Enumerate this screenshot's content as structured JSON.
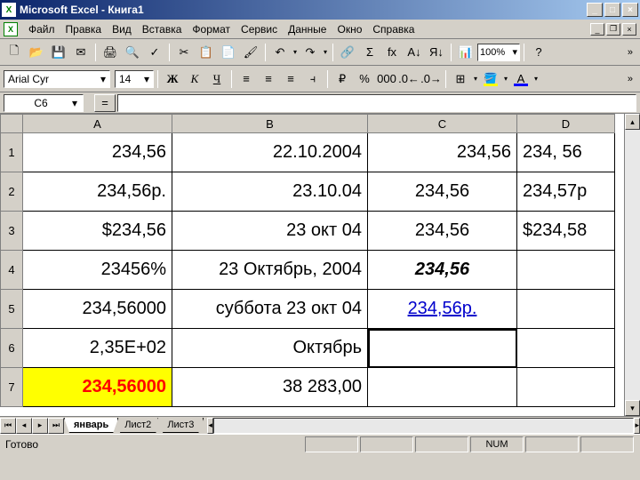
{
  "title": "Microsoft Excel - Книга1",
  "menu": [
    "Файл",
    "Правка",
    "Вид",
    "Вставка",
    "Формат",
    "Сервис",
    "Данные",
    "Окно",
    "Справка"
  ],
  "font": {
    "name": "Arial Cyr",
    "size": "14"
  },
  "zoom": "100%",
  "nameBox": "C6",
  "columns": [
    "A",
    "B",
    "C",
    "D"
  ],
  "rows": [
    "1",
    "2",
    "3",
    "4",
    "5",
    "6",
    "7"
  ],
  "cells": {
    "A1": "234,56",
    "B1": "22.10.2004",
    "C1": "234,56",
    "D1": "234, 56",
    "A2": "234,56р.",
    "B2": "23.10.04",
    "C2": "234,56",
    "D2": "234,57р",
    "A3": "$234,56",
    "B3": "23 окт 04",
    "C3": "234,56",
    "D3": "$234,58",
    "A4": "23456%",
    "B4": "23 Октябрь, 2004",
    "C4": "234,56",
    "D4": "",
    "A5": "234,56000",
    "B5": "суббота 23 окт 04",
    "C5": "234,56р.",
    "D5": "",
    "A6": "2,35E+02",
    "B6": "Октябрь",
    "C6": "",
    "D6": "",
    "A7": "234,56000",
    "B7": "38 283,00",
    "C7": "",
    "D7": ""
  },
  "tabs": [
    "январь",
    "Лист2",
    "Лист3"
  ],
  "activeTab": 0,
  "status": "Готово",
  "numlock": "NUM",
  "formatBtns": {
    "bold": "Ж",
    "italic": "К",
    "underline": "Ч",
    "currency": "%",
    "thousands": "000"
  },
  "icons": {
    "new": "🗋",
    "open": "📂",
    "save": "💾",
    "mail": "✉",
    "print": "🖨",
    "preview": "🔍",
    "spell": "✓",
    "cut": "✂",
    "copy": "📋",
    "paste": "📄",
    "brush": "🖌",
    "undo": "↶",
    "redo": "↷",
    "link": "🔗",
    "sum": "Σ",
    "fx": "fx",
    "sortAsc": "A↓",
    "sortDesc": "Я↓",
    "chart": "📊",
    "help": "?"
  }
}
